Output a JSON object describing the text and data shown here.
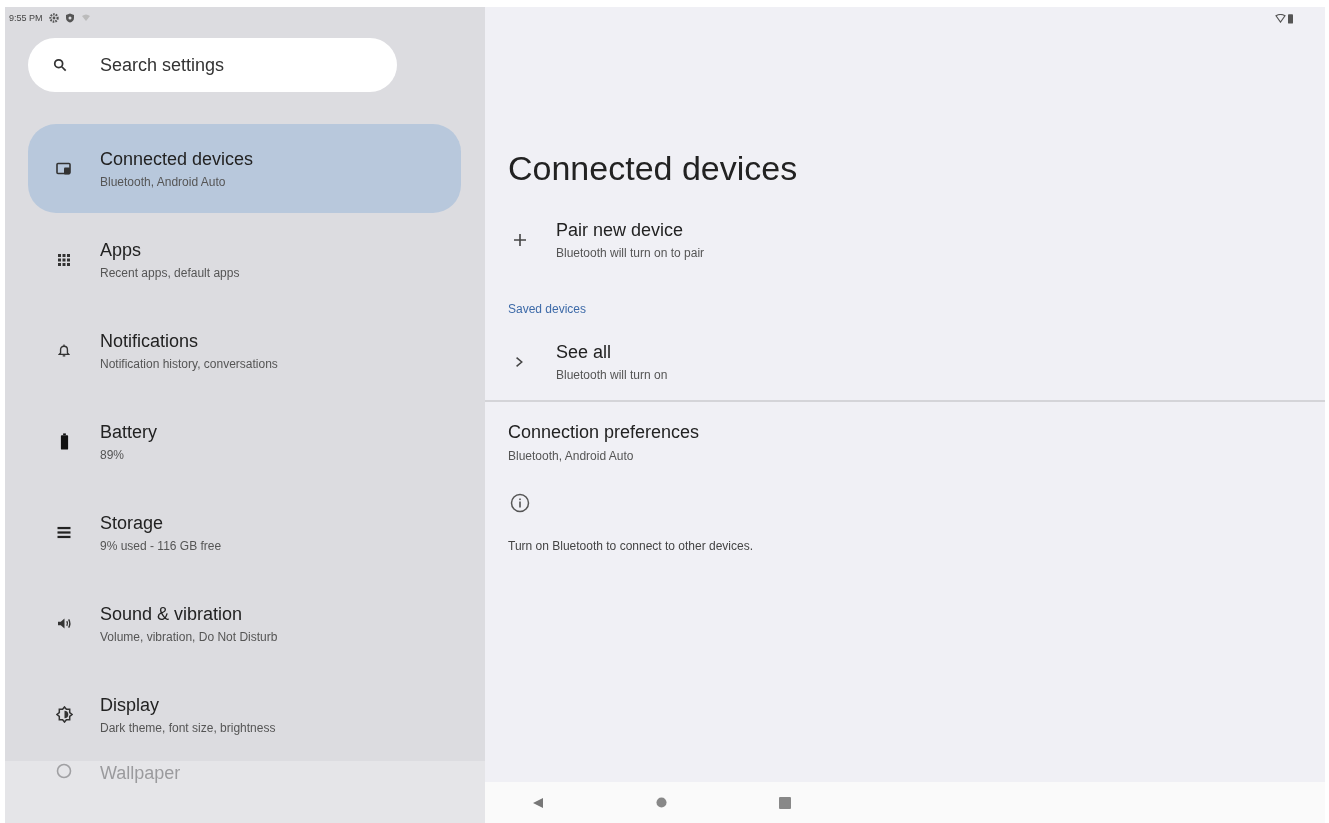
{
  "status_bar": {
    "time": "9:55 PM"
  },
  "search": {
    "placeholder": "Search settings"
  },
  "sidebar": {
    "items": [
      {
        "title": "Connected devices",
        "subtitle": "Bluetooth, Android Auto",
        "selected": true
      },
      {
        "title": "Apps",
        "subtitle": "Recent apps, default apps",
        "selected": false
      },
      {
        "title": "Notifications",
        "subtitle": "Notification history, conversations",
        "selected": false
      },
      {
        "title": "Battery",
        "subtitle": "89%",
        "selected": false
      },
      {
        "title": "Storage",
        "subtitle": "9% used - 116 GB free",
        "selected": false
      },
      {
        "title": "Sound & vibration",
        "subtitle": "Volume, vibration, Do Not Disturb",
        "selected": false
      },
      {
        "title": "Display",
        "subtitle": "Dark theme, font size, brightness",
        "selected": false
      },
      {
        "title": "Wallpaper",
        "selected": false
      }
    ]
  },
  "page": {
    "title": "Connected devices",
    "pair": {
      "title": "Pair new device",
      "subtitle": "Bluetooth will turn on to pair"
    },
    "section_header": "Saved devices",
    "see_all": {
      "title": "See all",
      "subtitle": "Bluetooth will turn on"
    },
    "preferences": {
      "title": "Connection preferences",
      "subtitle": "Bluetooth, Android Auto"
    },
    "footer": "Turn on Bluetooth to connect to other devices."
  }
}
